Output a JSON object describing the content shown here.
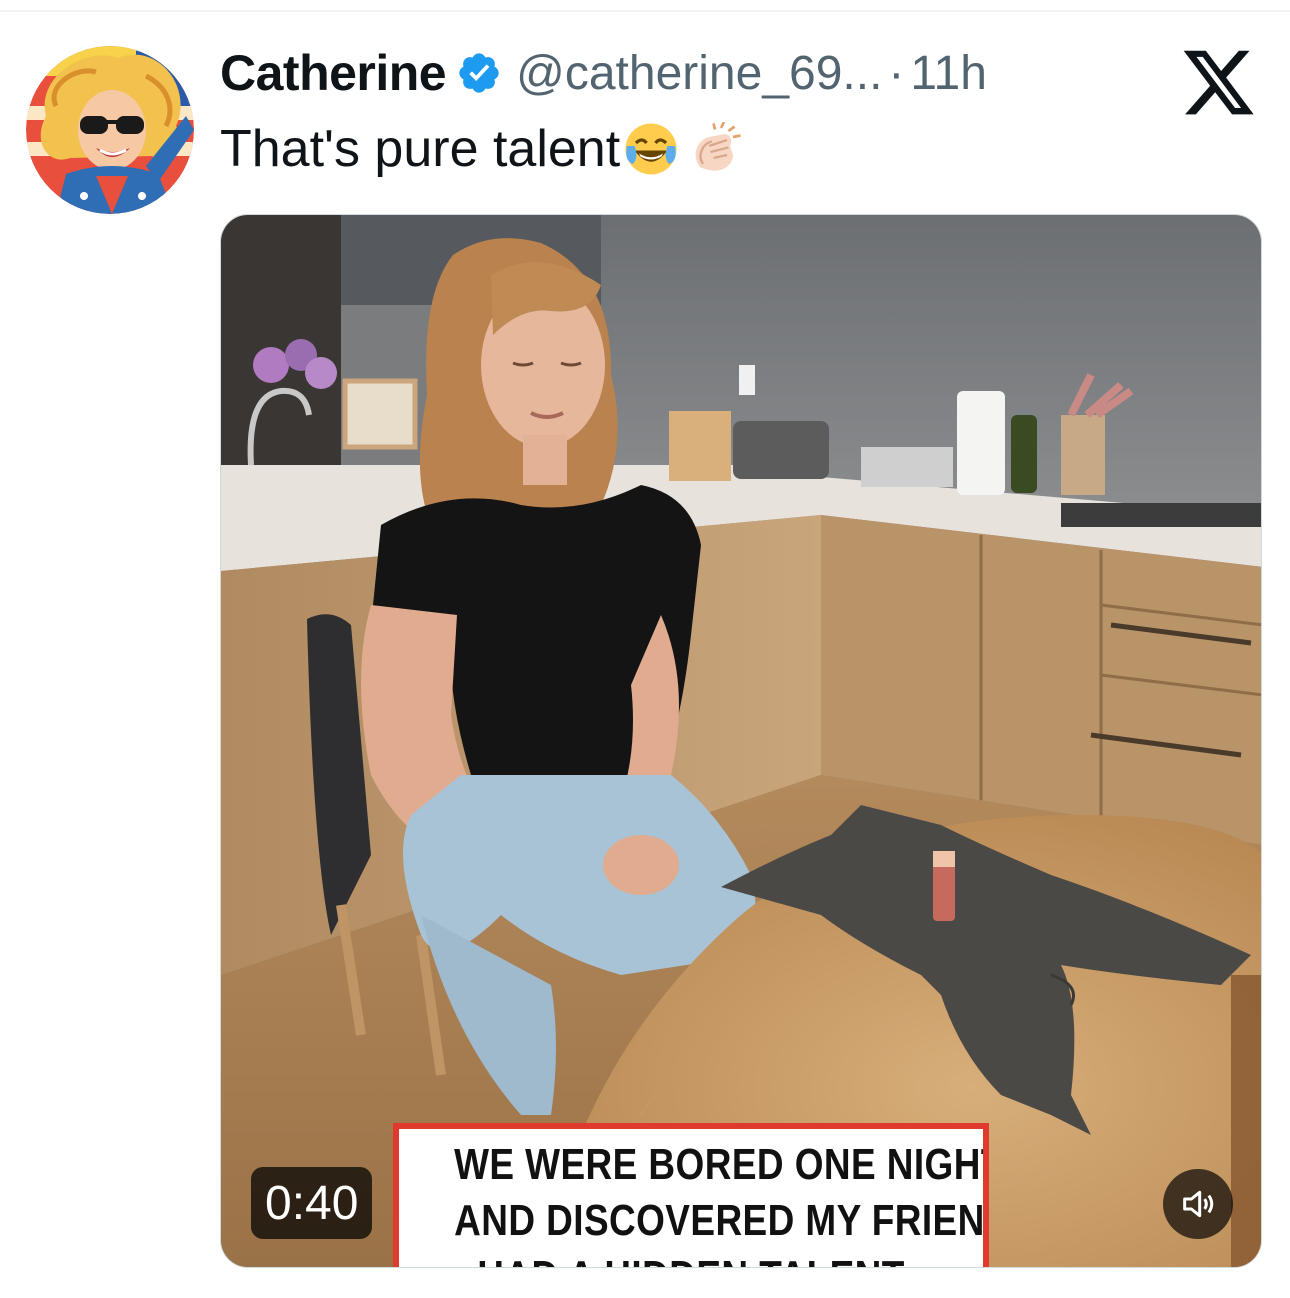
{
  "tweet": {
    "author_name": "Catherine",
    "handle": "@catherine_69...",
    "separator": "·",
    "time": "11h",
    "text": "That's pure talent",
    "text_emojis": [
      "face-with-tears-of-joy-icon",
      "clapping-hands-icon"
    ]
  },
  "media": {
    "duration": "0:40",
    "caption_lines": [
      "WE WERE BORED ONE NIGHT",
      "AND DISCOVERED MY FRIEND",
      "HAD A HIDDEN TALENT"
    ],
    "caption_border_color": "#e0392e"
  },
  "colors": {
    "verified_badge": "#1d9bf0",
    "secondary_text": "#536471",
    "primary_text": "#0f1419"
  },
  "icons": {
    "verified": "verified-badge-icon",
    "brand": "x-logo-icon",
    "volume": "speaker-muted-icon"
  }
}
